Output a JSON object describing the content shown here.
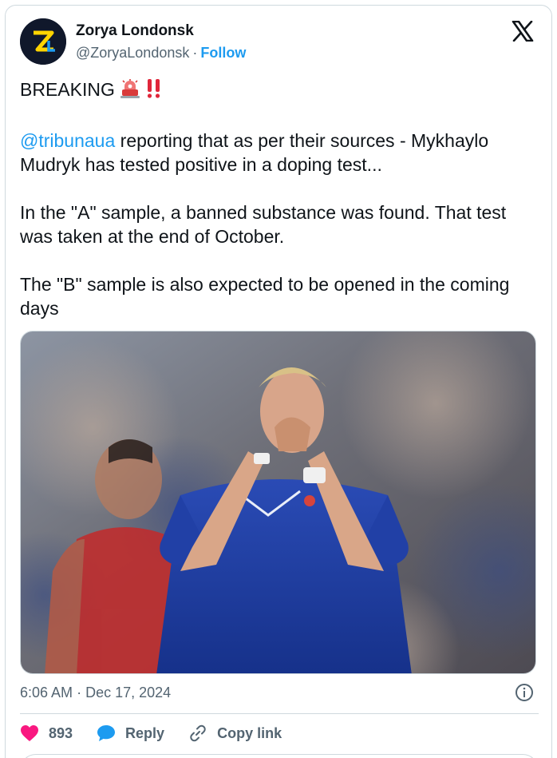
{
  "author": {
    "name": "Zorya Londonsk",
    "handle": "@ZoryaLondonsk",
    "separator": "·",
    "follow_label": "Follow",
    "avatar_letter": "Z",
    "colors": {
      "avatar_bg": "#10182b",
      "avatar_z": "#ffd400",
      "avatar_accent": "#1d9bf0"
    }
  },
  "header_icon": "x-logo-icon",
  "tweet": {
    "line_breaking": "BREAKING",
    "emojis": [
      "police-light-icon",
      "double-exclamation-icon"
    ],
    "mention": "@tribunaua",
    "para1_rest": " reporting that as per their sources - Mykhaylo Mudryk has tested positive in a doping test...",
    "para2": "In the \"A\" sample, a banned substance was found. That test was taken at the end of October.",
    "para3": "The \"B\" sample is also expected to be opened in the coming days"
  },
  "media": {
    "kind": "photo",
    "subject": "footballer-covering-face-icon"
  },
  "meta": {
    "time": "6:06 AM",
    "separator": "·",
    "date": "Dec 17, 2024",
    "info_icon": "info-icon"
  },
  "actions": {
    "likes_count": "893",
    "reply_label": "Reply",
    "copy_label": "Copy link"
  },
  "colors": {
    "text": "#0f1419",
    "secondary": "#536471",
    "link": "#1d9bf0",
    "like": "#f91880",
    "border": "#cfd9de"
  }
}
